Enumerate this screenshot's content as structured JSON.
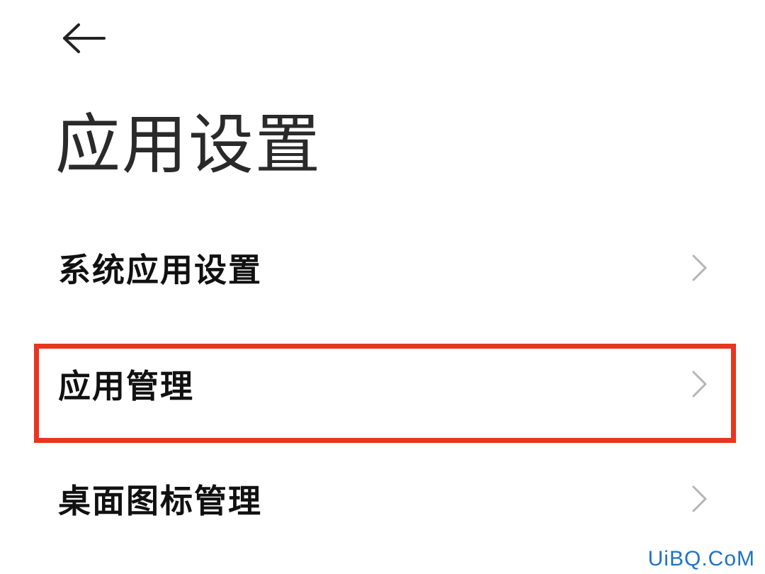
{
  "header": {
    "back_icon": "arrow-left-icon",
    "title": "应用设置"
  },
  "menu": {
    "items": [
      {
        "label": "系统应用设置",
        "icon": "chevron-right-icon"
      },
      {
        "label": "应用管理",
        "icon": "chevron-right-icon",
        "highlighted": true
      },
      {
        "label": "桌面图标管理",
        "icon": "chevron-right-icon"
      }
    ]
  },
  "highlight": {
    "color": "#e8351f"
  },
  "watermark": {
    "text": "UiBQ.CoM",
    "color": "#1e73c8"
  },
  "colors": {
    "background": "#ffffff",
    "text": "#111111",
    "chevron": "#b5b5b5"
  }
}
